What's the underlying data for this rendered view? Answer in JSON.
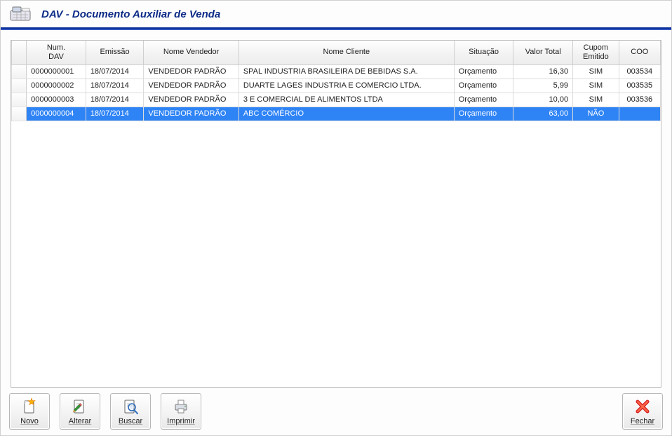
{
  "header": {
    "title": "DAV - Documento Auxiliar de Venda"
  },
  "table": {
    "columns": {
      "num": "Num.\nDAV",
      "emissao": "Emissão",
      "vendedor": "Nome Vendedor",
      "cliente": "Nome Cliente",
      "situacao": "Situação",
      "valor": "Valor Total",
      "cupom": "Cupom Emitido",
      "coo": "COO"
    },
    "selectedIndex": 3,
    "rows": [
      {
        "num": "0000000001",
        "emissao": "18/07/2014",
        "vendedor": "VENDEDOR PADRÃO",
        "cliente": "SPAL INDUSTRIA BRASILEIRA DE BEBIDAS S.A.",
        "situacao": "Orçamento",
        "valor": "16,30",
        "cupom": "SIM",
        "coo": "003534"
      },
      {
        "num": "0000000002",
        "emissao": "18/07/2014",
        "vendedor": "VENDEDOR PADRÃO",
        "cliente": "DUARTE LAGES INDUSTRIA E COMERCIO LTDA.",
        "situacao": "Orçamento",
        "valor": "5,99",
        "cupom": "SIM",
        "coo": "003535"
      },
      {
        "num": "0000000003",
        "emissao": "18/07/2014",
        "vendedor": "VENDEDOR PADRÃO",
        "cliente": "3 E COMERCIAL DE ALIMENTOS LTDA",
        "situacao": "Orçamento",
        "valor": "10,00",
        "cupom": "SIM",
        "coo": "003536"
      },
      {
        "num": "0000000004",
        "emissao": "18/07/2014",
        "vendedor": "VENDEDOR PADRÃO",
        "cliente": "ABC COMÉRCIO",
        "situacao": "Orçamento",
        "valor": "63,00",
        "cupom": "NÃO",
        "coo": ""
      }
    ]
  },
  "toolbar": {
    "novo": "Novo",
    "alterar": "Alterar",
    "buscar": "Buscar",
    "imprimir": "Imprimir",
    "fechar": "Fechar"
  }
}
